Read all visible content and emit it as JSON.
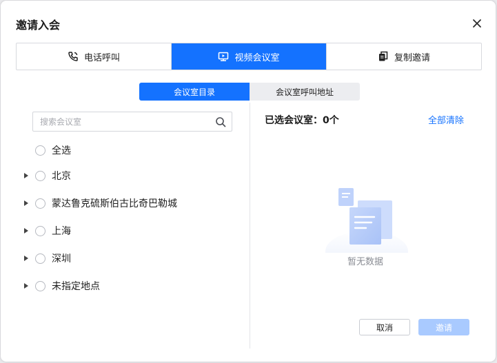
{
  "dialog": {
    "title": "邀请入会"
  },
  "tabs": [
    {
      "label": "电话呼叫",
      "icon": "phone-icon"
    },
    {
      "label": "视频会议室",
      "icon": "video-room-icon",
      "active": true
    },
    {
      "label": "复制邀请",
      "icon": "copy-icon"
    }
  ],
  "subtabs": [
    {
      "label": "会议室目录",
      "active": true
    },
    {
      "label": "会议室呼叫地址"
    }
  ],
  "search": {
    "placeholder": "搜索会议室"
  },
  "tree": {
    "select_all": "全选",
    "items": [
      {
        "label": "北京"
      },
      {
        "label": "蒙达鲁克硫斯伯古比奇巴勒城"
      },
      {
        "label": "上海"
      },
      {
        "label": "深圳"
      },
      {
        "label": "未指定地点"
      }
    ]
  },
  "selected": {
    "label": "已选会议室：0个",
    "clear_all": "全部清除"
  },
  "empty": {
    "text": "暂无数据"
  },
  "footer": {
    "cancel": "取消",
    "invite": "邀请"
  },
  "colors": {
    "accent": "#1472ff",
    "disabled_button": "#a9caff"
  }
}
